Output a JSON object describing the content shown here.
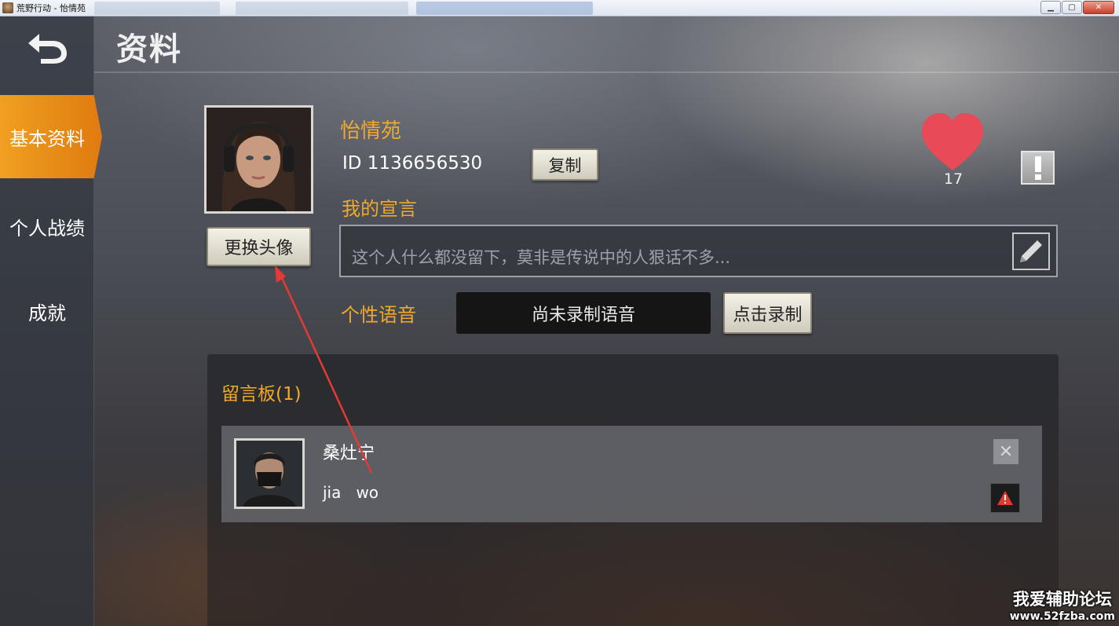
{
  "window": {
    "title": "荒野行动 - 怡情苑",
    "controls": {
      "minimize": "▁",
      "maximize": "▢",
      "close": "✕"
    }
  },
  "sidebar": {
    "back_icon": "back-arrow-icon",
    "items": [
      {
        "label": "基本资料",
        "active": true
      },
      {
        "label": "个人战绩",
        "active": false
      },
      {
        "label": "成就",
        "active": false
      }
    ]
  },
  "header": {
    "title": "资料"
  },
  "profile": {
    "nickname": "怡情苑",
    "id_text": "ID 1136656530",
    "copy_label": "复制",
    "change_avatar_label": "更换头像",
    "likes": "17",
    "declaration_label": "我的宣言",
    "declaration_placeholder": "这个人什么都没留下，莫非是传说中的人狠话不多...",
    "voice_label": "个性语音",
    "voice_status": "尚未录制语音",
    "record_label": "点击录制"
  },
  "board": {
    "title": "留言板(1)",
    "messages": [
      {
        "author": "桑灶宁",
        "text": "jia   wo"
      }
    ]
  },
  "watermark": {
    "line1": "我爱辅助论坛",
    "line2": "www.52fzba.com"
  },
  "colors": {
    "accent": "#f1a92a",
    "active_tab": "#f0a020",
    "heart": "#e94a57"
  }
}
